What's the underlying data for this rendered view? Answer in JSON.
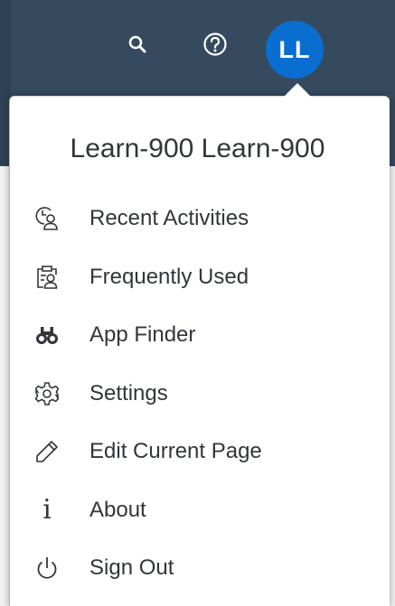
{
  "shellbar": {
    "search_icon": "search-icon",
    "help_icon": "help-icon",
    "avatar_initials": "LL"
  },
  "user": {
    "display_name": "Learn-900 Learn-900"
  },
  "menu": {
    "items": [
      {
        "label": "Recent Activities",
        "icon": "recent-activities-icon"
      },
      {
        "label": "Frequently Used",
        "icon": "frequently-used-icon"
      },
      {
        "label": "App Finder",
        "icon": "binoculars-icon"
      },
      {
        "label": "Settings",
        "icon": "gear-icon"
      },
      {
        "label": "Edit Current Page",
        "icon": "pencil-icon"
      },
      {
        "label": "About",
        "icon": "info-icon"
      },
      {
        "label": "Sign Out",
        "icon": "power-icon"
      }
    ]
  },
  "colors": {
    "shellbar_bg": "#354a5f",
    "avatar_bg": "#0a6ed1",
    "text": "#32363a",
    "popover_bg": "#ffffff"
  }
}
